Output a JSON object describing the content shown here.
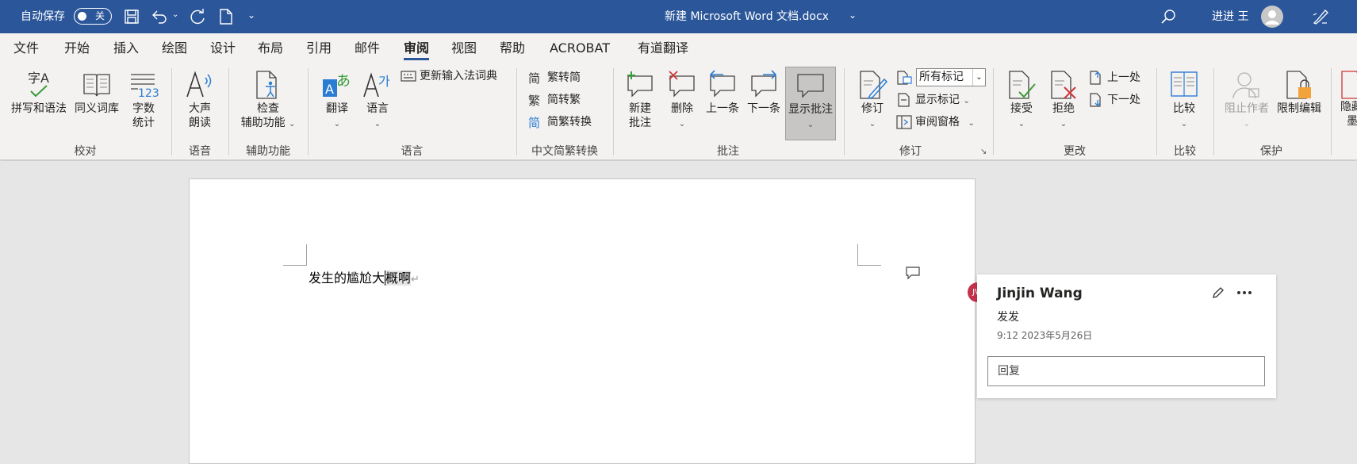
{
  "titlebar": {
    "autosave_label": "自动保存",
    "autosave_state": "关",
    "doc_title": "新建 Microsoft Word 文档.docx",
    "user_name": "进进 王"
  },
  "tabs": [
    "文件",
    "开始",
    "插入",
    "绘图",
    "设计",
    "布局",
    "引用",
    "邮件",
    "审阅",
    "视图",
    "帮助",
    "ACROBAT",
    "有道翻译"
  ],
  "active_tab": "审阅",
  "comment_pane_button": "批注",
  "ribbon": {
    "proofing": {
      "spell": "拼写和语法",
      "thesaurus": "同义词库",
      "wordcount_1": "字数",
      "wordcount_2": "统计",
      "group": "校对"
    },
    "speech": {
      "read_1": "大声",
      "read_2": "朗读",
      "group": "语音"
    },
    "accessibility": {
      "check_1": "检查",
      "check_2": "辅助功能",
      "group": "辅助功能"
    },
    "language": {
      "translate": "翻译",
      "language": "语言",
      "update_ime": "更新输入法词典",
      "group": "语言"
    },
    "chinese": {
      "to_simplified": "繁转简",
      "to_traditional": "简转繁",
      "convert": "简繁转换",
      "group": "中文简繁转换"
    },
    "comments": {
      "new_1": "新建",
      "new_2": "批注",
      "delete": "删除",
      "prev": "上一条",
      "next": "下一条",
      "show": "显示批注",
      "group": "批注"
    },
    "tracking": {
      "track": "修订",
      "markup_select": "所有标记",
      "show_markup": "显示标记",
      "review_pane": "审阅窗格",
      "group": "修订"
    },
    "changes": {
      "accept": "接受",
      "reject": "拒绝",
      "previous": "上一处",
      "next": "下一处",
      "group": "更改"
    },
    "compare": {
      "compare": "比较",
      "group": "比较"
    },
    "protect": {
      "block_authors": "阻止作者",
      "restrict": "限制编辑",
      "group": "保护"
    },
    "ink": {
      "hide_1": "隐藏",
      "hide_2": "墨迹"
    }
  },
  "document": {
    "text_before": "发生的尴尬大",
    "text_selected": "概啊",
    "pilcrow": "↵"
  },
  "comment": {
    "initials": "JW",
    "author": "Jinjin Wang",
    "body": "发发",
    "timestamp": "9:12 2023年5月26日",
    "reply_placeholder": "回复"
  },
  "colors": {
    "title_blue": "#2b579a",
    "avatar_red": "#c4314b"
  }
}
